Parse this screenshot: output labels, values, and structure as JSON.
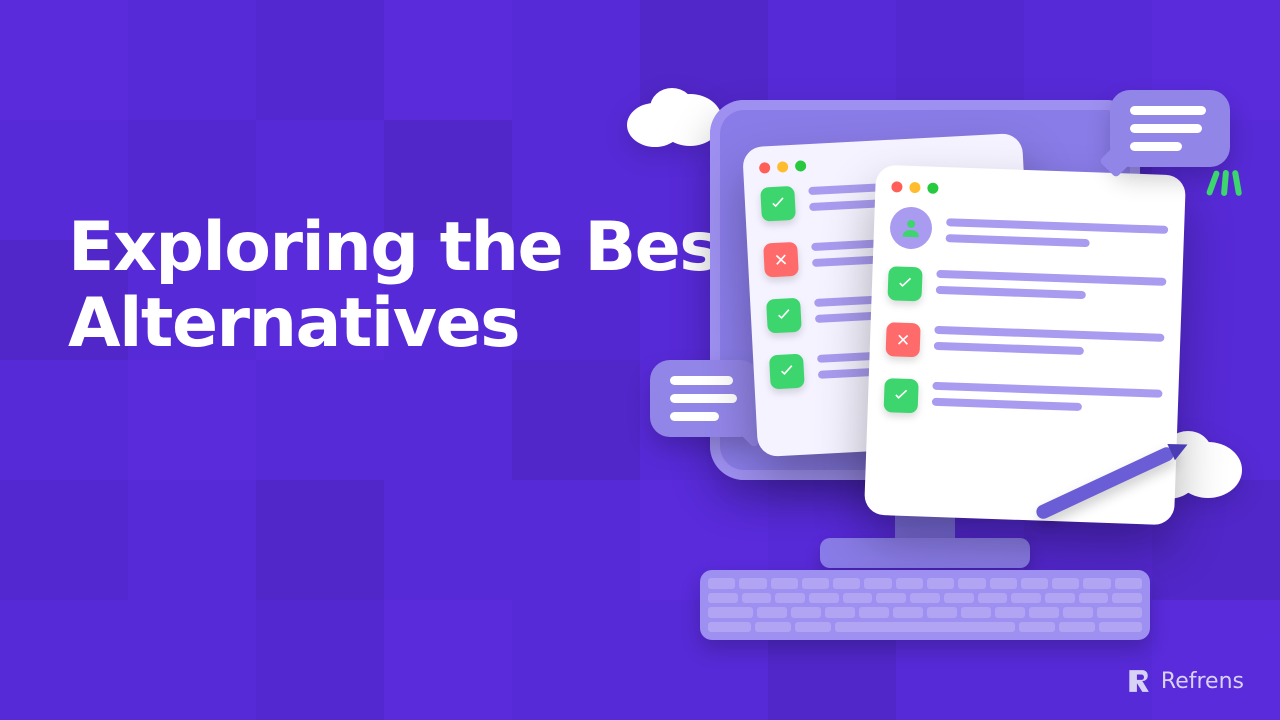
{
  "headline": "Exploring the Best Typeform Alternatives",
  "brand": "Refrens",
  "back_window_items": [
    {
      "status": "check"
    },
    {
      "status": "cross"
    },
    {
      "status": "check"
    },
    {
      "status": "check"
    }
  ],
  "front_window_items": [
    {
      "status": "check"
    },
    {
      "status": "cross"
    },
    {
      "status": "check"
    }
  ]
}
